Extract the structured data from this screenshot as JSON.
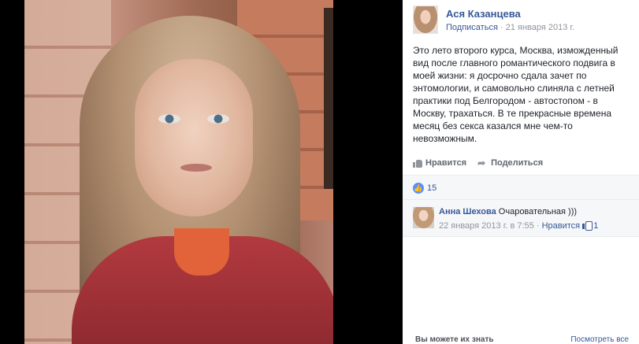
{
  "post": {
    "author": "Ася Казанцева",
    "follow_label": "Подписаться",
    "separator": "·",
    "date": "21 января 2013 г.",
    "text": "Это лето второго курса, Москва, изможденный вид после главного романтического подвига в моей жизни: я досрочно сдала зачет по энтомологии, и самовольно слиняла с летней практики под Белгородом - автостопом - в Москву, трахаться. В те прекрасные времена месяц без секса казался мне чем-то невозможным.",
    "like_label": "Нравится",
    "share_label": "Поделиться",
    "likes_count": "15"
  },
  "comment": {
    "author": "Анна Шехова",
    "text": "Очаровательная )))",
    "date": "22 января 2013 г. в 7:55",
    "separator": "·",
    "like_label": "Нравится",
    "likes": "1"
  },
  "footer": {
    "pymk": "Вы можете их знать",
    "see_all": "Посмотреть все"
  },
  "icons": {
    "like": "thumb-up-icon",
    "share": "share-arrow-icon"
  },
  "colors": {
    "link": "#365899",
    "like_badge": "#5890ff",
    "muted": "#90949c"
  }
}
